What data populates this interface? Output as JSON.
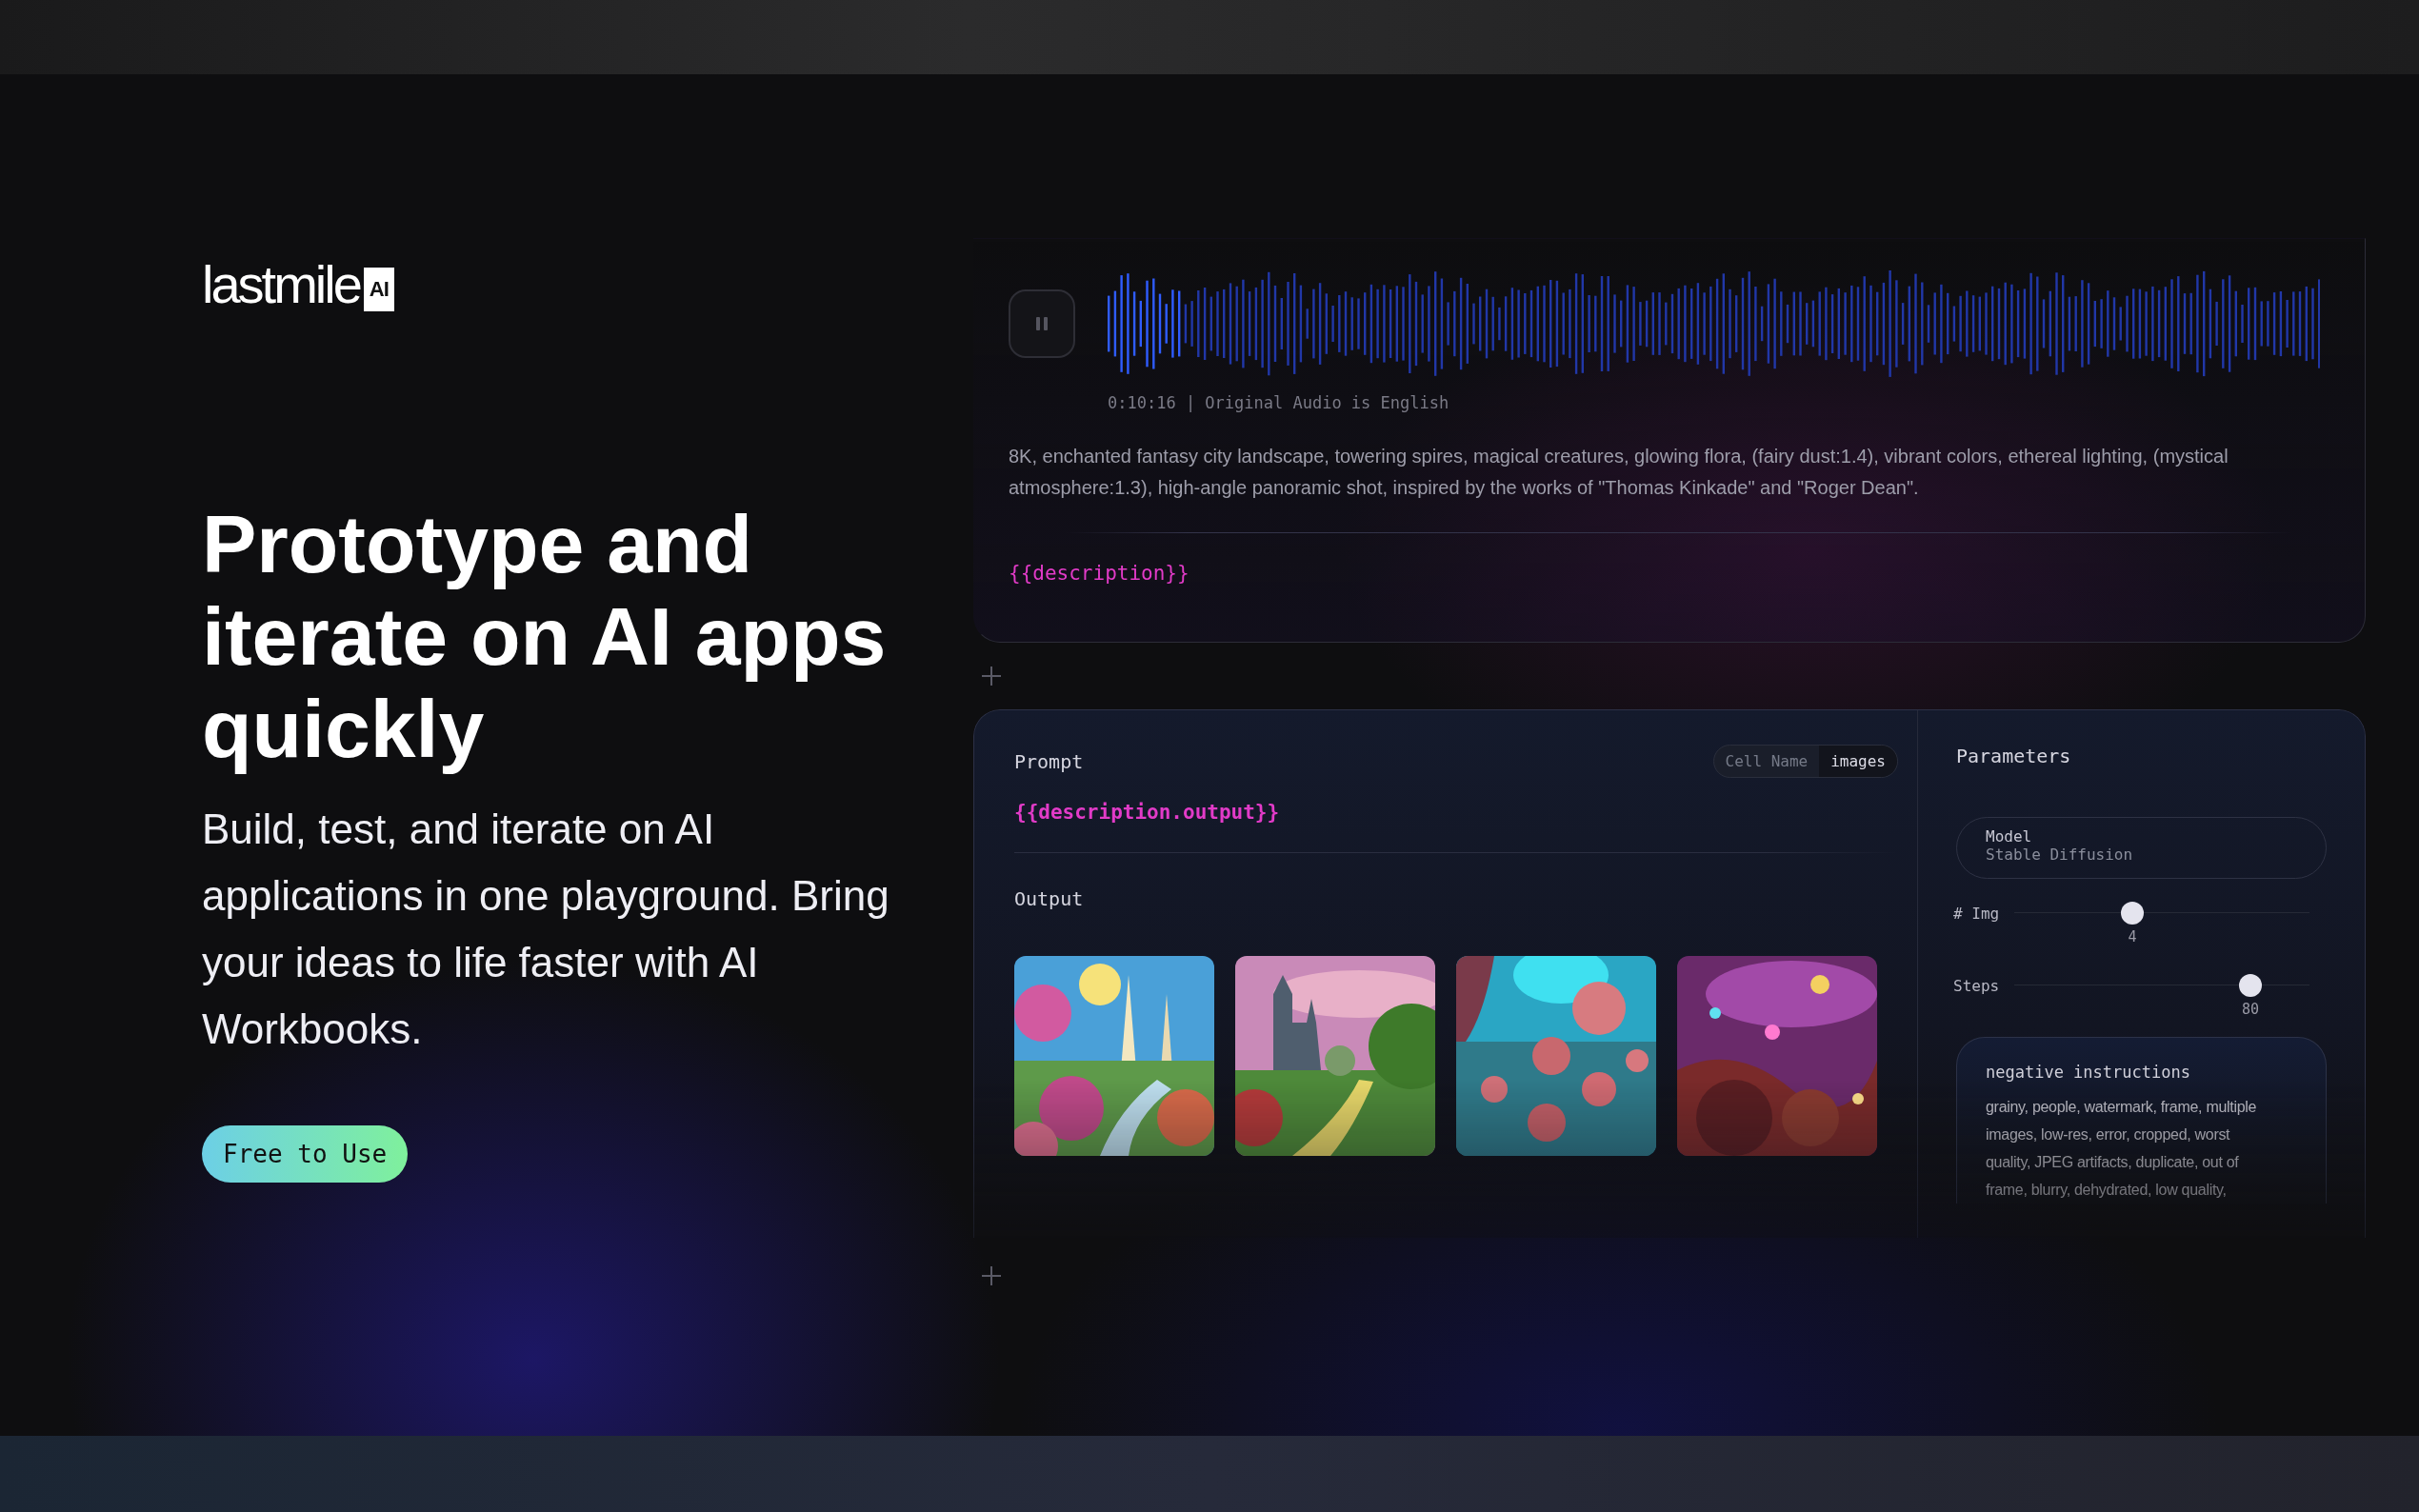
{
  "logo": {
    "wordmark": "lastmile",
    "badge": "AI"
  },
  "hero": {
    "heading": "Prototype and iterate on AI apps quickly",
    "text": "Build, test, and iterate on AI applications in one playground. Bring your ideas to life faster with AI Workbooks.",
    "button": "Free to Use"
  },
  "audio_cell": {
    "playing": true,
    "caption": "0:10:16 | Original Audio is English",
    "transcript": "8K, enchanted fantasy city landscape, towering spires, magical creatures, glowing flora, (fairy dust:1.4), vibrant colors, ethereal lighting, (mystical atmosphere:1.3), high-angle panoramic shot, inspired by the works of \"Thomas Kinkade\" and \"Roger Dean\".",
    "variable": "{{description}}"
  },
  "prompt_cell": {
    "title": "Prompt",
    "cell_name_label": "Cell Name",
    "cell_name": "images",
    "prompt": "{{description.output}}",
    "output_title": "Output"
  },
  "parameters": {
    "title": "Parameters",
    "model": {
      "label": "Model",
      "value": "Stable Diffusion"
    },
    "sliders": [
      {
        "label": "# Img",
        "level": 0.4,
        "reading": "4"
      },
      {
        "label": "Steps",
        "level": 0.8,
        "reading": "80"
      }
    ],
    "negative": {
      "title": "negative instructions",
      "text": "grainy, people, watermark, frame, multiple images, low-res, error, cropped, worst quality, JPEG artifacts, duplicate, out of frame, blurry, dehydrated, low quality,"
    }
  }
}
